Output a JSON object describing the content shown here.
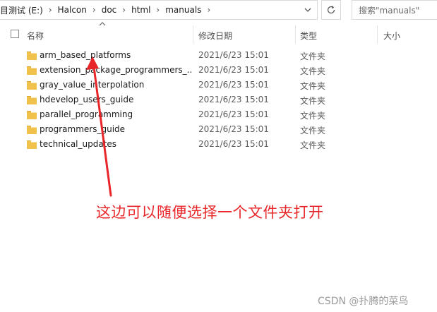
{
  "address_bar": {
    "crumbs": [
      "目测试 (E:)",
      "Halcon",
      "doc",
      "html",
      "manuals"
    ],
    "dropdown_icon": "chevron-down-icon"
  },
  "refresh_icon": "refresh-icon",
  "search": {
    "placeholder": "搜索\"manuals\""
  },
  "columns": {
    "name": "名称",
    "date_modified": "修改日期",
    "type": "类型",
    "size": "大小"
  },
  "sort_indicator": "sort-ascending-icon",
  "files": [
    {
      "name": "arm_based_platforms",
      "date": "2021/6/23 15:01",
      "type": "文件夹"
    },
    {
      "name": "extension_package_programmers_...",
      "date": "2021/6/23 15:01",
      "type": "文件夹"
    },
    {
      "name": "gray_value_interpolation",
      "date": "2021/6/23 15:01",
      "type": "文件夹"
    },
    {
      "name": "hdevelop_users_guide",
      "date": "2021/6/23 15:01",
      "type": "文件夹"
    },
    {
      "name": "parallel_programming",
      "date": "2021/6/23 15:01",
      "type": "文件夹"
    },
    {
      "name": "programmers_guide",
      "date": "2021/6/23 15:01",
      "type": "文件夹"
    },
    {
      "name": "technical_updates",
      "date": "2021/6/23 15:01",
      "type": "文件夹"
    }
  ],
  "annotation": {
    "text": "这边可以随便选择一个文件夹打开",
    "color": "#e8262a"
  },
  "watermark": "CSDN @扑腾的菜鸟",
  "colors": {
    "folder": "#f0c24b",
    "accent_red": "#e8262a"
  }
}
